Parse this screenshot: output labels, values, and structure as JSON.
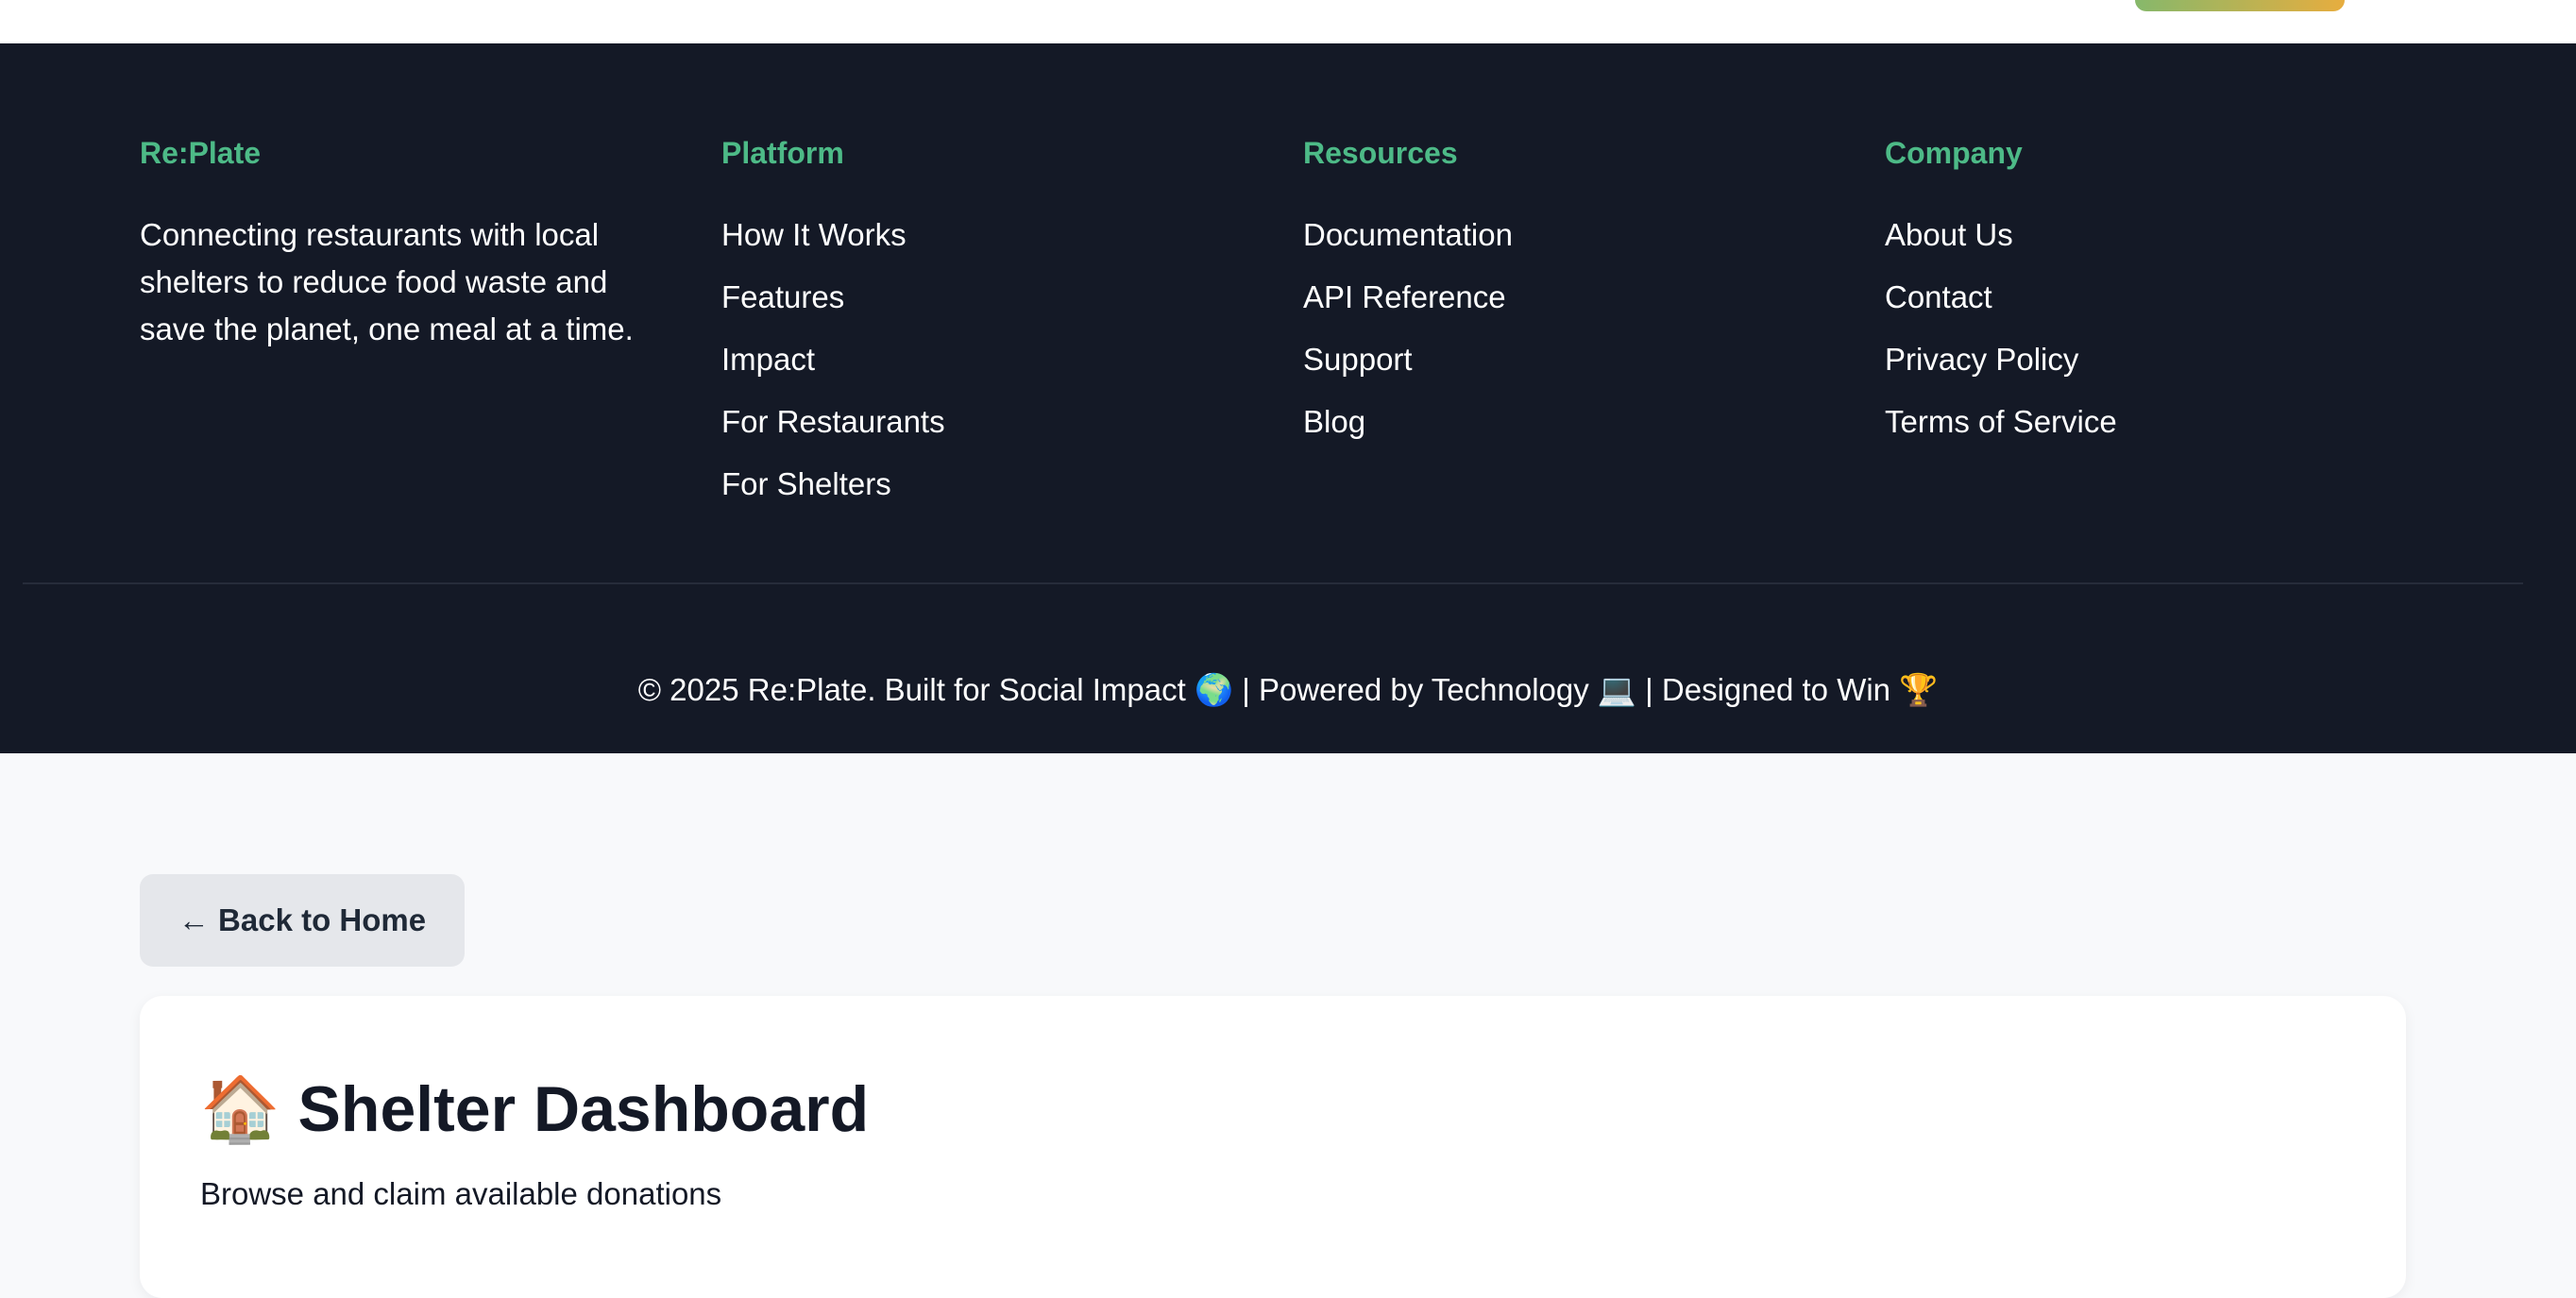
{
  "footer": {
    "brand": {
      "name": "Re:Plate",
      "description": "Connecting restaurants with local shelters to reduce food waste and save the planet, one meal at a time."
    },
    "columns": [
      {
        "heading": "Platform",
        "links": [
          "How It Works",
          "Features",
          "Impact",
          "For Restaurants",
          "For Shelters"
        ]
      },
      {
        "heading": "Resources",
        "links": [
          "Documentation",
          "API Reference",
          "Support",
          "Blog"
        ]
      },
      {
        "heading": "Company",
        "links": [
          "About Us",
          "Contact",
          "Privacy Policy",
          "Terms of Service"
        ]
      }
    ],
    "copyright": "© 2025 Re:Plate. Built for Social Impact 🌍 | Powered by Technology 💻 | Designed to Win 🏆"
  },
  "back_button": {
    "label": "← Back to Home"
  },
  "dashboard": {
    "title": "🏠 Shelter Dashboard",
    "subtitle": "Browse and claim available donations"
  },
  "colors": {
    "footer_bg": "#141926",
    "heading_accent": "#4dba87",
    "page_bg": "#f8f9fb",
    "button_bg": "#e5e7eb"
  }
}
